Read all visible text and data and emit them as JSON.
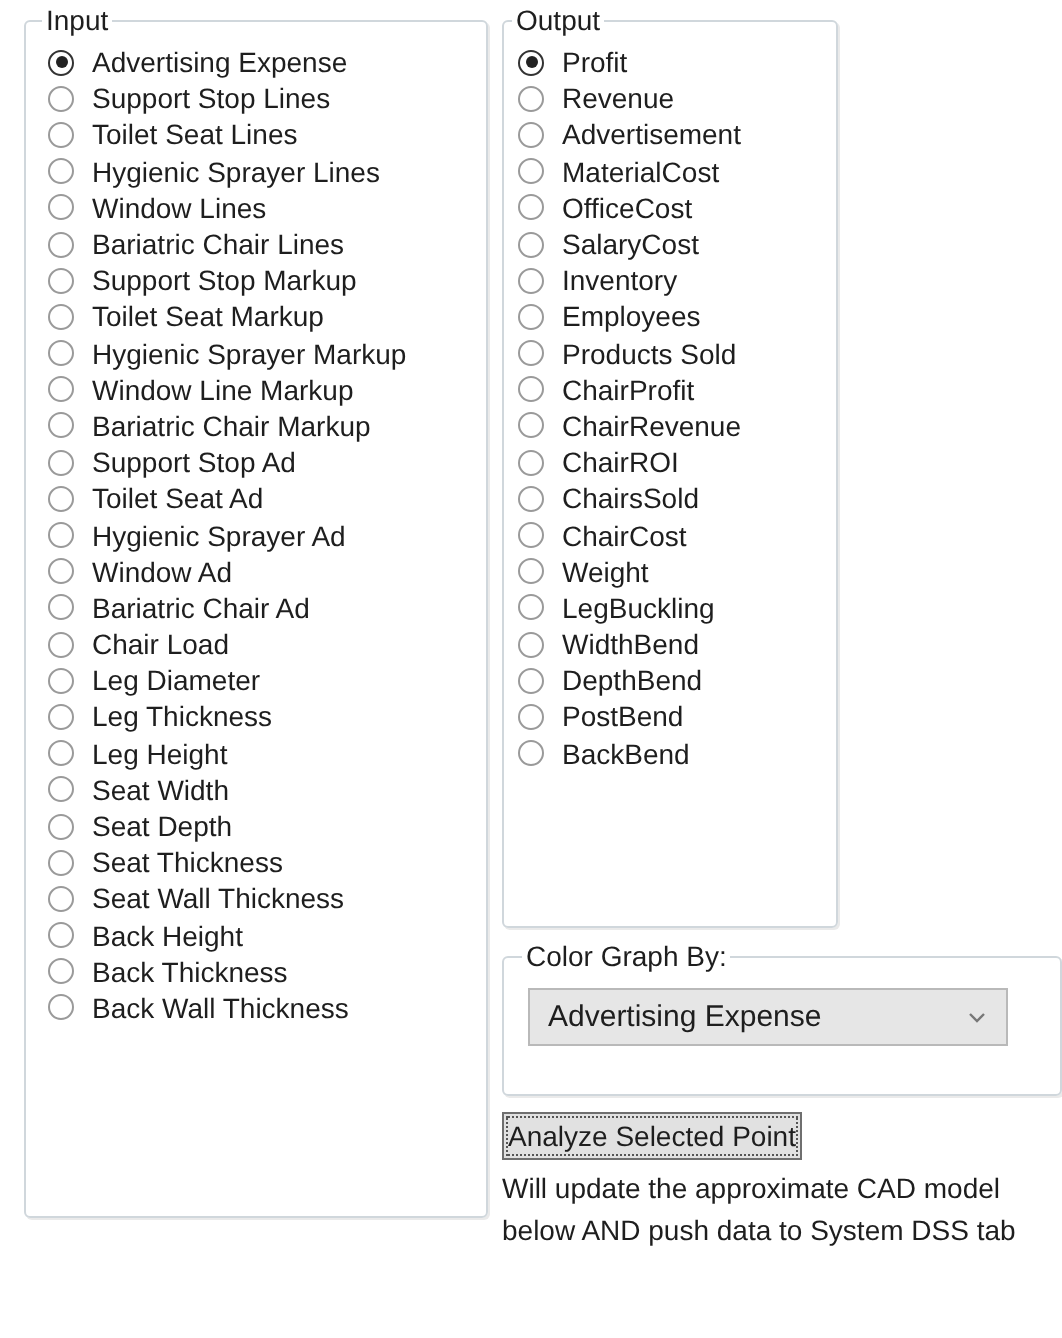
{
  "input": {
    "title": "Input",
    "options": [
      {
        "label": "Advertising Expense",
        "selected": true
      },
      {
        "label": "Support Stop Lines",
        "selected": false
      },
      {
        "label": "Toilet Seat Lines",
        "selected": false
      },
      {
        "label": "Hygienic Sprayer Lines",
        "selected": false
      },
      {
        "label": "Window Lines",
        "selected": false
      },
      {
        "label": "Bariatric Chair Lines",
        "selected": false
      },
      {
        "label": "Support Stop Markup",
        "selected": false
      },
      {
        "label": "Toilet Seat Markup",
        "selected": false
      },
      {
        "label": "Hygienic Sprayer Markup",
        "selected": false
      },
      {
        "label": "Window Line Markup",
        "selected": false
      },
      {
        "label": "Bariatric Chair Markup",
        "selected": false
      },
      {
        "label": "Support Stop Ad",
        "selected": false
      },
      {
        "label": "Toilet Seat Ad",
        "selected": false
      },
      {
        "label": "Hygienic Sprayer Ad",
        "selected": false
      },
      {
        "label": "Window Ad",
        "selected": false
      },
      {
        "label": "Bariatric Chair Ad",
        "selected": false
      },
      {
        "label": "Chair Load",
        "selected": false
      },
      {
        "label": "Leg Diameter",
        "selected": false
      },
      {
        "label": "Leg Thickness",
        "selected": false
      },
      {
        "label": "Leg Height",
        "selected": false
      },
      {
        "label": "Seat Width",
        "selected": false
      },
      {
        "label": "Seat Depth",
        "selected": false
      },
      {
        "label": "Seat Thickness",
        "selected": false
      },
      {
        "label": "Seat Wall Thickness",
        "selected": false
      },
      {
        "label": "Back Height",
        "selected": false
      },
      {
        "label": "Back Thickness",
        "selected": false
      },
      {
        "label": "Back Wall Thickness",
        "selected": false
      }
    ]
  },
  "output": {
    "title": "Output",
    "options": [
      {
        "label": "Profit",
        "selected": true
      },
      {
        "label": "Revenue",
        "selected": false
      },
      {
        "label": "Advertisement",
        "selected": false
      },
      {
        "label": "MaterialCost",
        "selected": false
      },
      {
        "label": "OfficeCost",
        "selected": false
      },
      {
        "label": "SalaryCost",
        "selected": false
      },
      {
        "label": "Inventory",
        "selected": false
      },
      {
        "label": "Employees",
        "selected": false
      },
      {
        "label": "Products Sold",
        "selected": false
      },
      {
        "label": "ChairProfit",
        "selected": false
      },
      {
        "label": "ChairRevenue",
        "selected": false
      },
      {
        "label": "ChairROI",
        "selected": false
      },
      {
        "label": "ChairsSold",
        "selected": false
      },
      {
        "label": "ChairCost",
        "selected": false
      },
      {
        "label": "Weight",
        "selected": false
      },
      {
        "label": "LegBuckling",
        "selected": false
      },
      {
        "label": "WidthBend",
        "selected": false
      },
      {
        "label": "DepthBend",
        "selected": false
      },
      {
        "label": "PostBend",
        "selected": false
      },
      {
        "label": "BackBend",
        "selected": false
      }
    ]
  },
  "color_graph": {
    "title": "Color Graph By:",
    "value": "Advertising Expense"
  },
  "analyze_button": "Analyze Selected Point",
  "note": "Will update the approximate CAD model below AND push data to System DSS tab"
}
